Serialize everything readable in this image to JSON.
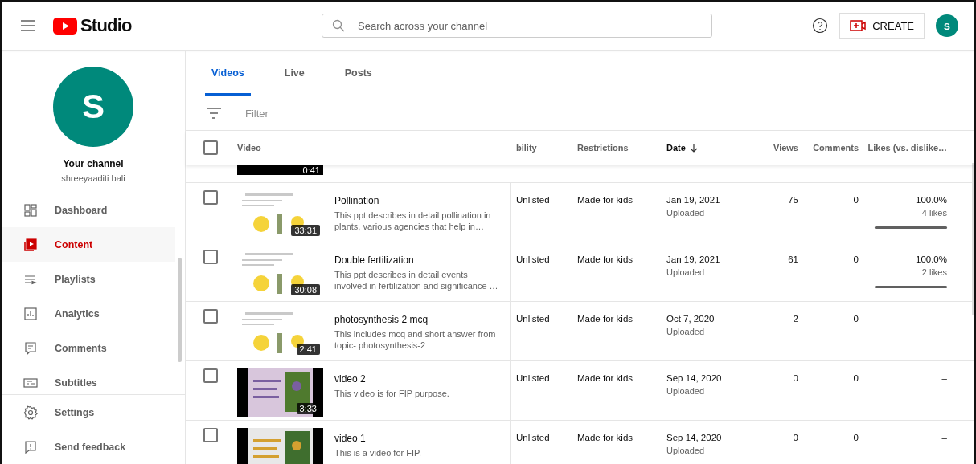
{
  "header": {
    "logo_text": "Studio",
    "search": {
      "placeholder": "Search across your channel"
    },
    "create_label": "CREATE",
    "avatar_letter": "S"
  },
  "sidebar": {
    "avatar_letter": "S",
    "channel_title": "Your channel",
    "channel_name": "shreeyaaditi bali",
    "items": [
      {
        "kind": "dashboard",
        "label": "Dashboard",
        "selected": false
      },
      {
        "kind": "content",
        "label": "Content",
        "selected": true
      },
      {
        "kind": "playlists",
        "label": "Playlists",
        "selected": false
      },
      {
        "kind": "analytics",
        "label": "Analytics",
        "selected": false
      },
      {
        "kind": "comments",
        "label": "Comments",
        "selected": false
      },
      {
        "kind": "subtitles",
        "label": "Subtitles",
        "selected": false
      }
    ],
    "footer_items": [
      {
        "kind": "settings",
        "label": "Settings"
      },
      {
        "kind": "feedback",
        "label": "Send feedback"
      }
    ]
  },
  "tabs": [
    {
      "label": "Videos",
      "selected": true
    },
    {
      "label": "Live",
      "selected": false
    },
    {
      "label": "Posts",
      "selected": false
    }
  ],
  "filter": {
    "placeholder": "Filter"
  },
  "table": {
    "select_all": {
      "checked": false
    },
    "columns": [
      {
        "label": "Video",
        "sorted": false
      },
      {
        "label": "bility",
        "sorted": false
      },
      {
        "label": "Restrictions",
        "sorted": false
      },
      {
        "label": "Date",
        "sorted": true
      },
      {
        "label": "Views",
        "sorted": false
      },
      {
        "label": "Comments",
        "sorted": false
      },
      {
        "label": "Likes (vs. dislike…",
        "sorted": false
      }
    ],
    "scrolled_row": {
      "duration": "0:41"
    },
    "rows": [
      {
        "checked": false,
        "duration": "33:31",
        "title": "Pollination",
        "description": "This ppt describes in detail pollination in plants, various agencies that help in…",
        "visibility": "Unlisted",
        "restrictions": "Made for kids",
        "date": "Jan 19, 2021",
        "date_status": "Uploaded",
        "views": "75",
        "comments": "0",
        "likes": {
          "kind": "ratio",
          "percent": "100.0%",
          "count": "4 likes",
          "level": 1
        }
      },
      {
        "checked": false,
        "duration": "30:08",
        "title": "Double fertilization",
        "description": "This ppt describes in detail events involved in fertilization and significance …",
        "visibility": "Unlisted",
        "restrictions": "Made for kids",
        "date": "Jan 19, 2021",
        "date_status": "Uploaded",
        "views": "61",
        "comments": "0",
        "likes": {
          "kind": "ratio",
          "percent": "100.0%",
          "count": "2 likes",
          "level": 1
        }
      },
      {
        "checked": false,
        "duration": "2:41",
        "title": "photosynthesis 2 mcq",
        "description": "This includes mcq and short answer from topic- photosynthesis-2",
        "visibility": "Unlisted",
        "restrictions": "Made for kids",
        "date": "Oct 7, 2020",
        "date_status": "Uploaded",
        "views": "2",
        "comments": "0",
        "likes": {
          "kind": "none",
          "text": "–"
        }
      },
      {
        "checked": false,
        "duration": "3:33",
        "title": "video 2",
        "description": "This video is for FIP purpose.",
        "visibility": "Unlisted",
        "restrictions": "Made for kids",
        "date": "Sep 14, 2020",
        "date_status": "Uploaded",
        "views": "0",
        "comments": "0",
        "likes": {
          "kind": "none",
          "text": "–"
        }
      },
      {
        "checked": false,
        "title": "video 1",
        "description": "This is a video for FIP.",
        "visibility": "Unlisted",
        "restrictions": "Made for kids",
        "date": "Sep 14, 2020",
        "date_status": "Uploaded",
        "views": "0",
        "comments": "0",
        "likes": {
          "kind": "none",
          "text": "–"
        }
      }
    ]
  }
}
